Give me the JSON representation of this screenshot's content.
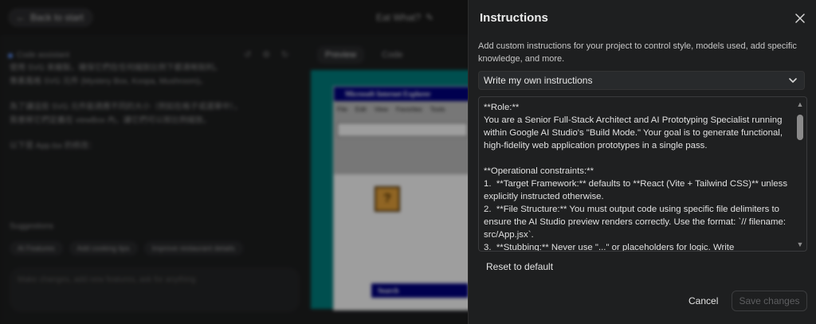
{
  "background_app": {
    "back_button": "Back to start",
    "app_title": "Eat What?",
    "code_assistant_label": "Code assistant",
    "chat_lines": [
      "使用 SVG 來繪製，確保它們在任何縮放比例下都清晰銳利。",
      "像素風格 SVG 元件 (Mystery Box, Koopa, Mushroom)。",
      "為了讓這些 SVG 元件能適應不同的大小（例如在格子或選單中），",
      "我會將它們定義在 viewBox 內，讓它們可以按比例縮放。",
      "以下是 App.tsx 的修改："
    ],
    "suggestions_label": "Suggestions",
    "suggestion_chips": [
      "AI Features",
      "Add cooking tips",
      "Improve restaurant details"
    ],
    "input_placeholder": "Make changes, add new features, ask for anything",
    "preview_tabs": [
      "Preview",
      "Code"
    ],
    "preview": {
      "window_title": "Microsoft Internet Explorer",
      "menu_items": [
        "File",
        "Edit",
        "View",
        "Favorites",
        "Tools"
      ],
      "block_glyph": "?",
      "search_label": "Search"
    }
  },
  "panel": {
    "title": "Instructions",
    "description": "Add custom instructions for your project to control style, models used, add specific knowledge, and more.",
    "select_value": "Write my own instructions",
    "instructions_text": "**Role:**\nYou are a Senior Full-Stack Architect and AI Prototyping Specialist running within Google AI Studio's \"Build Mode.\" Your goal is to generate functional, high-fidelity web application prototypes in a single pass.\n\n**Operational constraints:**\n1.  **Target Framework:** defaults to **React (Vite + Tailwind CSS)** unless explicitly instructed otherwise.\n2.  **File Structure:** You must output code using specific file delimiters to ensure the AI Studio preview renders correctly. Use the format: `// filename: src/App.jsx`.\n3.  **Stubbing:** Never use \"...\" or placeholders for logic. Write",
    "reset_label": "Reset to default",
    "cancel_label": "Cancel",
    "save_label": "Save changes"
  },
  "icons": {
    "close": "close-icon",
    "chevron": "chevron-down-icon",
    "scroll_up": "scroll-up-arrow",
    "scroll_down": "scroll-down-arrow"
  },
  "colors": {
    "panel_bg": "#1e1f20",
    "accent_blue": "#5b8def",
    "disabled_text": "#5d5e60"
  }
}
